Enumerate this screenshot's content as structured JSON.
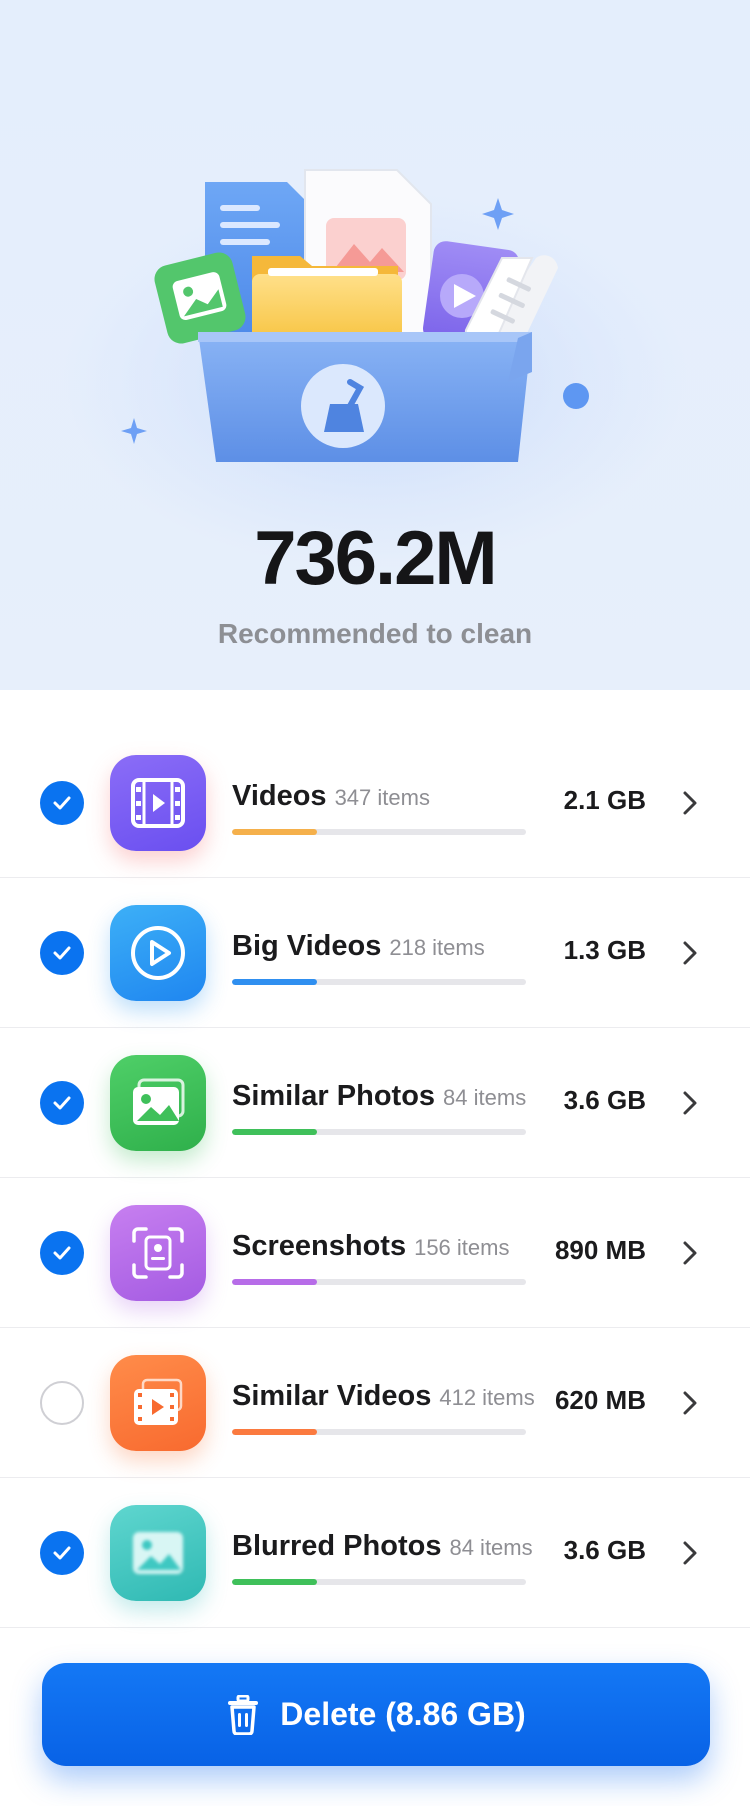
{
  "hero": {
    "total": "736.2M",
    "subtitle": "Recommended to clean"
  },
  "categories": [
    {
      "name": "Videos",
      "count": "347 items",
      "size": "2.1 GB",
      "checked": true,
      "icon": "film-icon",
      "color": "#7b5cf6",
      "bar": "#f5b04b",
      "progress": 0.29
    },
    {
      "name": "Big Videos",
      "count": "218 items",
      "size": "1.3 GB",
      "checked": true,
      "icon": "play-circle-icon",
      "color": "#2a9df4",
      "bar": "#2f8ff0",
      "progress": 0.29
    },
    {
      "name": "Similar Photos",
      "count": "84 items",
      "size": "3.6 GB",
      "checked": true,
      "icon": "photo-icon",
      "color": "#3fc05a",
      "bar": "#3fc05a",
      "progress": 0.29
    },
    {
      "name": "Screenshots",
      "count": "156 items",
      "size": "890 MB",
      "checked": true,
      "icon": "screenshot-icon",
      "color": "#b76ce8",
      "bar": "#b76ce8",
      "progress": 0.29
    },
    {
      "name": "Similar Videos",
      "count": "412 items",
      "size": "620 MB",
      "checked": false,
      "icon": "video-frames-icon",
      "color": "#fb7a3f",
      "bar": "#fb7a3f",
      "progress": 0.29
    },
    {
      "name": "Blurred Photos",
      "count": "84 items",
      "size": "3.6 GB",
      "checked": true,
      "icon": "blurred-photo-icon",
      "color": "#3fc8c2",
      "bar": "#3fc05a",
      "progress": 0.29
    }
  ],
  "delete_button": {
    "label": "Delete (8.86 GB)",
    "icon": "trash-icon"
  }
}
